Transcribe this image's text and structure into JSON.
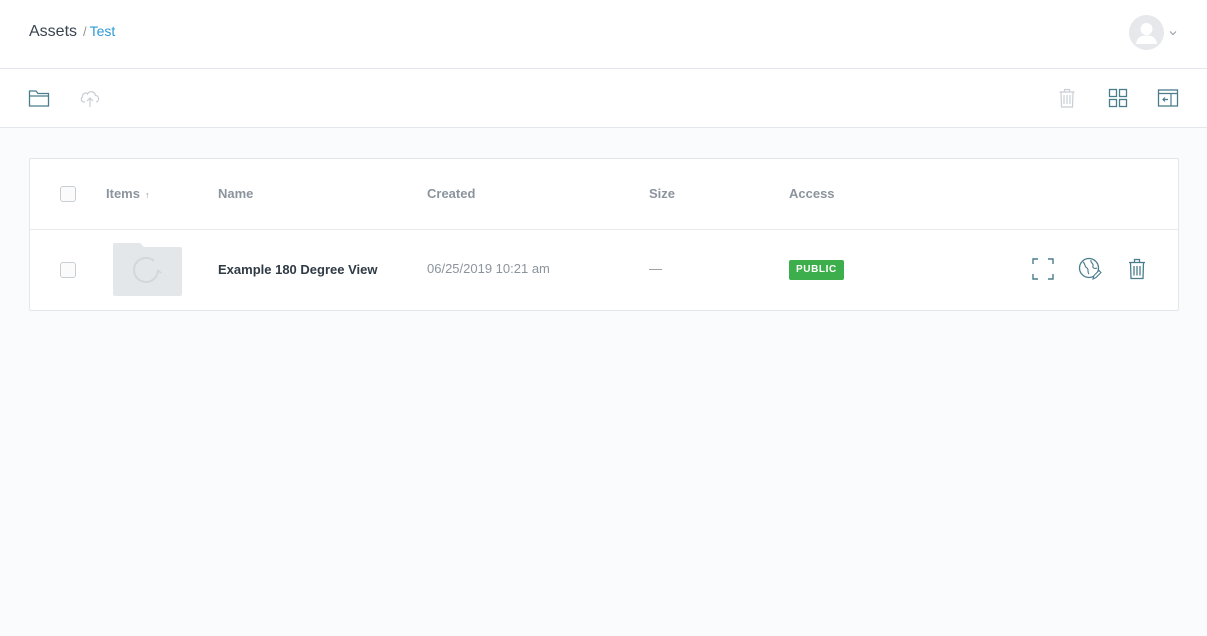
{
  "breadcrumb": {
    "root": "Assets",
    "separator": "/",
    "current": "Test"
  },
  "user_menu": {
    "avatar_icon": "user-avatar-icon",
    "chevron_icon": "chevron-down-icon"
  },
  "toolbar": {
    "left_icons": [
      "folder-icon",
      "cloud-upload-icon"
    ],
    "right_icons": [
      "trash-icon",
      "grid-view-icon",
      "collapse-panel-icon"
    ]
  },
  "table": {
    "columns": {
      "items": "Items",
      "items_sort": "↑",
      "name": "Name",
      "created": "Created",
      "size": "Size",
      "access": "Access"
    },
    "rows": [
      {
        "name": "Example 180 Degree View",
        "created": "06/25/2019 10:21 am",
        "size": "—",
        "access": "PUBLIC",
        "thumbnail_icon": "folder-loading-icon",
        "actions": [
          "fullscreen-icon",
          "globe-edit-icon",
          "trash-icon"
        ]
      }
    ]
  },
  "colors": {
    "link": "#2d9ad6",
    "badge_public": "#3cae4b",
    "icon_teal": "#4a7d8c",
    "icon_disabled": "#c8ced3"
  }
}
